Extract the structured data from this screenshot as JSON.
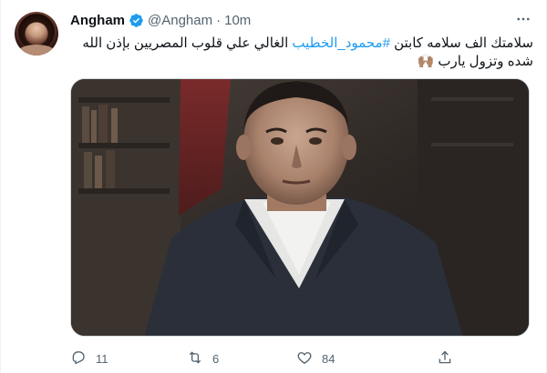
{
  "tweet": {
    "author_name": "Angham",
    "handle": "@Angham",
    "separator": "·",
    "time": "10m",
    "text_line1_pre": "سلامتك الف سلامه كابتن ",
    "hashtag": "#محمود_الخطيب",
    "text_line1_post": "  الغالي علي قلوب المصريين بإذن الله",
    "text_line2": "شده وتزول يارب 🙌🏽",
    "replies": "11",
    "retweets": "6",
    "likes": "84"
  },
  "colors": {
    "accent": "#1d9bf0",
    "secondary_text": "#536471",
    "primary_text": "#0f1419"
  },
  "icons": {
    "verified": "verified-badge-icon",
    "more": "more-icon",
    "reply": "reply-icon",
    "retweet": "retweet-icon",
    "like": "heart-icon",
    "share": "share-icon"
  }
}
